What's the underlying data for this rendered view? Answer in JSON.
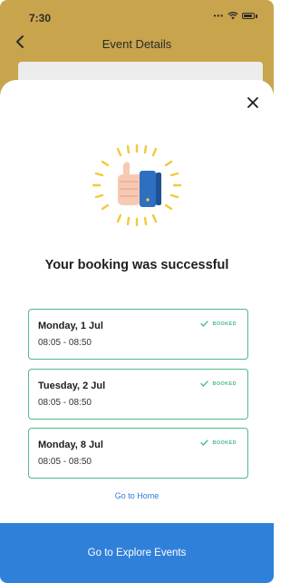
{
  "status_bar": {
    "time": "7:30"
  },
  "header": {
    "title": "Event Details"
  },
  "modal": {
    "title": "Your booking was successful",
    "bookings": [
      {
        "date": "Monday, 1 Jul",
        "time": "08:05 - 08:50",
        "status": "BOOKED"
      },
      {
        "date": "Tuesday, 2 Jul",
        "time": "08:05 - 08:50",
        "status": "BOOKED"
      },
      {
        "date": "Monday, 8 Jul",
        "time": "08:05 - 08:50",
        "status": "BOOKED"
      }
    ],
    "go_home_label": "Go to Home",
    "explore_button_label": "Go to Explore Events"
  },
  "colors": {
    "header_bg": "#c8a44c",
    "accent_green": "#4fb987",
    "link_blue": "#2b7bd6",
    "button_blue": "#2f80d9",
    "sleeve_blue": "#2f6fc0",
    "ray_yellow": "#f3c93b",
    "skin": "#f7c9b3"
  },
  "icons": [
    "back-arrow-icon",
    "close-icon",
    "thumbs-up-icon",
    "check-icon",
    "wifi-icon",
    "battery-icon"
  ]
}
